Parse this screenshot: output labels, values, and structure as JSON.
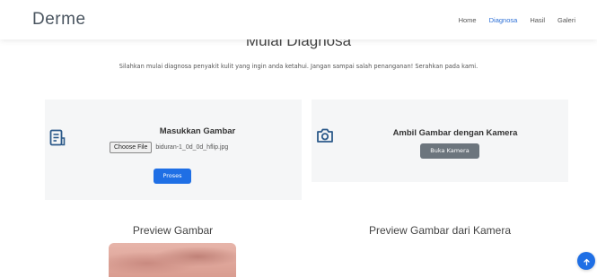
{
  "nav": {
    "brand": "Derme",
    "items": [
      {
        "label": "Home"
      },
      {
        "label": "Diagnosa"
      },
      {
        "label": "Hasil"
      },
      {
        "label": "Galeri"
      }
    ],
    "active_index": 1
  },
  "header": {
    "title": "Mulai Diagnosa",
    "subtitle": "Silahkan mulai diagnosa penyakit kulit yang ingin anda ketahui. Jangan sampai salah penanganan! Serahkan pada kami."
  },
  "upload_card": {
    "icon": "document-icon",
    "title": "Masukkan Gambar",
    "choose_label": "Choose File",
    "file_name": "biduran-1_0d_0d_hflip.jpg",
    "submit_label": "Proses"
  },
  "camera_card": {
    "icon": "camera-icon",
    "title": "Ambil Gambar dengan Kamera",
    "button_label": "Buka Kamera"
  },
  "preview": {
    "image_title": "Preview Gambar",
    "camera_title": "Preview Gambar dari Kamera"
  },
  "colors": {
    "primary": "#1f6fe5",
    "secondary": "#6c757d",
    "card_bg": "#f5f6f7",
    "nav_active": "#2c6fd6"
  },
  "scroll_top_icon": "arrow-up-icon"
}
